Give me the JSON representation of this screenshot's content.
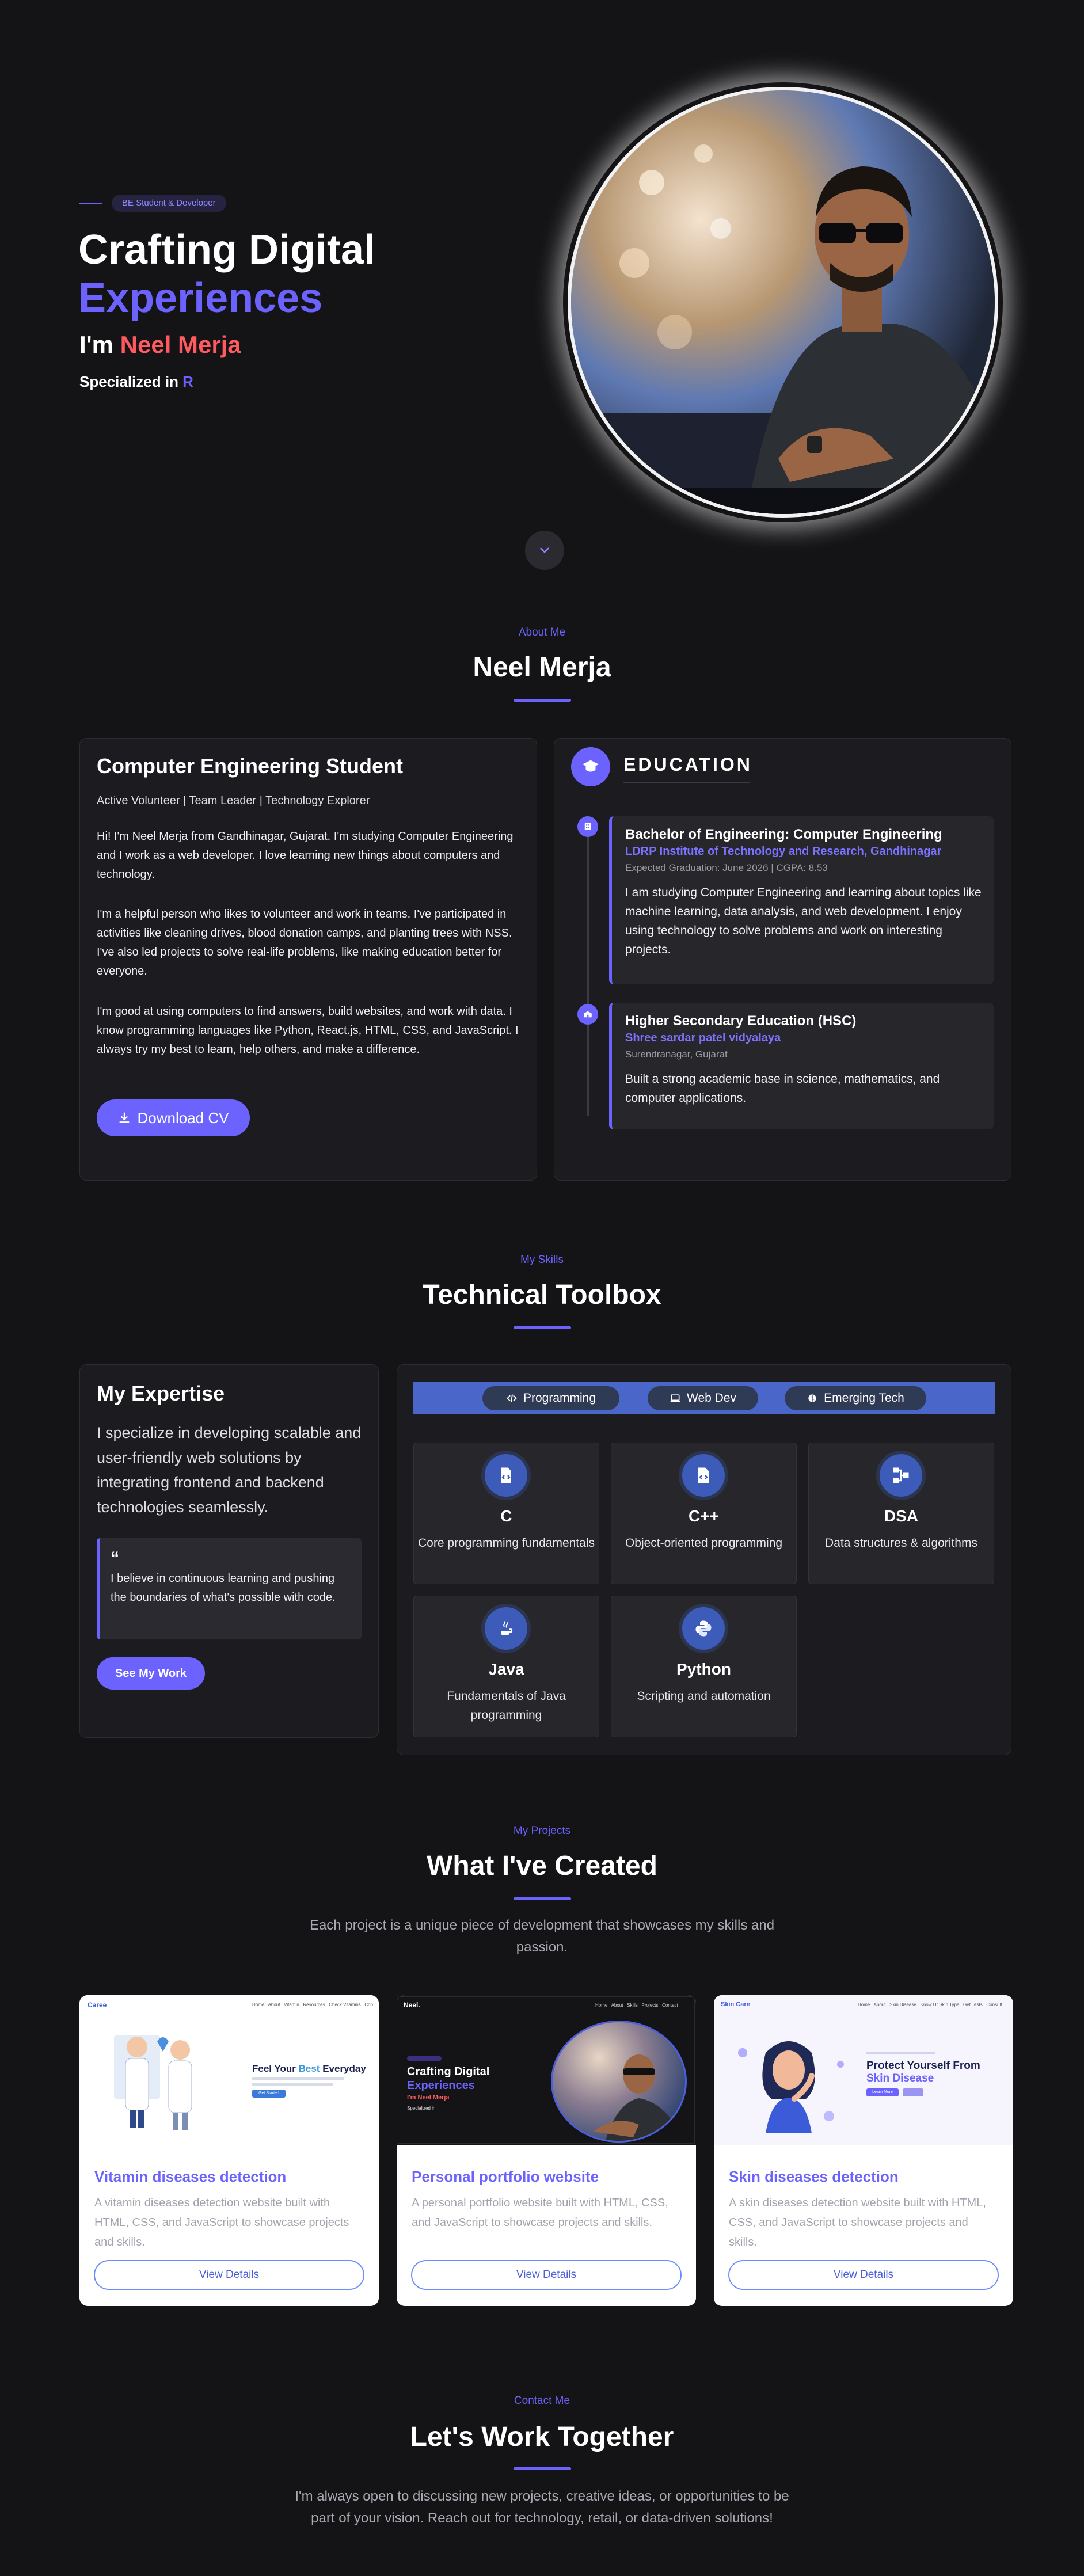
{
  "hero": {
    "badge": "BE Student & Developer",
    "title_line1": "Crafting Digital",
    "title_line2": "Experiences",
    "intro_prefix": "I'm ",
    "name": "Neel Merja",
    "spec_prefix": "Specialized in ",
    "spec_value": "R"
  },
  "about": {
    "subtitle": "About Me",
    "title": "Neel Merja",
    "card_title": "Computer Engineering Student",
    "tags": "Active Volunteer | Team Leader | Technology Explorer",
    "p1": "Hi! I'm Neel Merja from Gandhinagar, Gujarat. I'm studying Computer Engineering and I work as a web developer. I love learning new things about computers and technology.",
    "p2": "I'm a helpful person who likes to volunteer and work in teams. I've participated in activities like cleaning drives, blood donation camps, and planting trees with NSS. I've also led projects to solve real-life problems, like making education better for everyone.",
    "p3": "I'm good at using computers to find answers, build websites, and work with data. I know programming languages like Python, React.js, HTML, CSS, and JavaScript. I always try my best to learn, help others, and make a difference.",
    "download_label": "Download CV"
  },
  "education": {
    "title": "EDUCATION",
    "items": [
      {
        "degree": "Bachelor of Engineering: Computer Engineering",
        "institute": "LDRP Institute of Technology and Research, Gandhinagar",
        "meta": "Expected Graduation: June 2026 | CGPA: 8.53",
        "body": "I am studying Computer Engineering and learning about topics like machine learning, data analysis, and web development. I enjoy using technology to solve problems and work on interesting projects."
      },
      {
        "degree": "Higher Secondary Education (HSC)",
        "institute": "Shree sardar patel vidyalaya",
        "meta": "Surendranagar, Gujarat",
        "body": "Built a strong academic base in science, mathematics, and computer applications."
      }
    ]
  },
  "skills": {
    "subtitle": "My Skills",
    "title": "Technical Toolbox",
    "expertise_title": "My Expertise",
    "expertise_text": "I specialize in developing scalable and user-friendly web solutions by integrating frontend and backend technologies seamlessly.",
    "quote_mark": "“",
    "quote": "I believe in continuous learning and pushing the boundaries of what's possible with code.",
    "see_work_label": "See My Work",
    "tabs": [
      "Programming",
      "Web Dev",
      "Emerging Tech"
    ],
    "cards": [
      {
        "name": "C",
        "desc": "Core programming fundamentals",
        "icon": "file-code-icon"
      },
      {
        "name": "C++",
        "desc": "Object-oriented programming",
        "icon": "file-code-icon"
      },
      {
        "name": "DSA",
        "desc": "Data structures & algorithms",
        "icon": "network-icon"
      },
      {
        "name": "Java",
        "desc": "Fundamentals of Java programming",
        "icon": "java-icon"
      },
      {
        "name": "Python",
        "desc": "Scripting and automation",
        "icon": "python-icon"
      }
    ]
  },
  "projects": {
    "subtitle": "My Projects",
    "title": "What I've Created",
    "desc": "Each project is a unique piece of development that showcases my skills and passion.",
    "items": [
      {
        "title": "Vitamin diseases detection",
        "desc": "A vitamin diseases detection website built with HTML, CSS, and JavaScript to showcase projects and skills.",
        "button": "View Details",
        "shot_logo": "Caree",
        "shot_nav": "Home   About   Vitamin   Resources   Check Vitamins   Con",
        "shot_head1": "Feel Your ",
        "shot_head_accent": "Best",
        "shot_head2": " Everyday",
        "shot_cta": "Get Started"
      },
      {
        "title": "Personal portfolio website",
        "desc": "A personal portfolio website built with HTML, CSS, and JavaScript to showcase projects and skills.",
        "button": "View Details",
        "shot_logo": "Neel.",
        "shot_nav": "Home   About   Skills   Projects   Contact",
        "shot_head1": "Crafting Digital",
        "shot_head2": "Experiences",
        "shot_intro": "I'm Neel Merja",
        "shot_spec": "Specialized in"
      },
      {
        "title": "Skin diseases detection",
        "desc": "A skin diseases detection website built with HTML, CSS, and JavaScript to showcase projects and skills.",
        "button": "View Details",
        "shot_logo": "Skin Care",
        "shot_nav": "Home   About   Skin Disease   Know Ur Skin Type   Get Tests   Consult",
        "shot_head1": "Protect Yourself From",
        "shot_head2": "Skin Disease",
        "shot_cta": "Learn More"
      }
    ]
  },
  "contact": {
    "subtitle": "Contact Me",
    "title": "Let's Work Together",
    "desc": "I'm always open to discussing new projects, creative ideas, or opportunities to be part of your vision. Reach out for technology, retail, or data-driven solutions!"
  },
  "colors": {
    "background": "#141416",
    "accent": "#6c63ff",
    "name_accent": "#ff5a5f",
    "card": "#1c1c20"
  }
}
